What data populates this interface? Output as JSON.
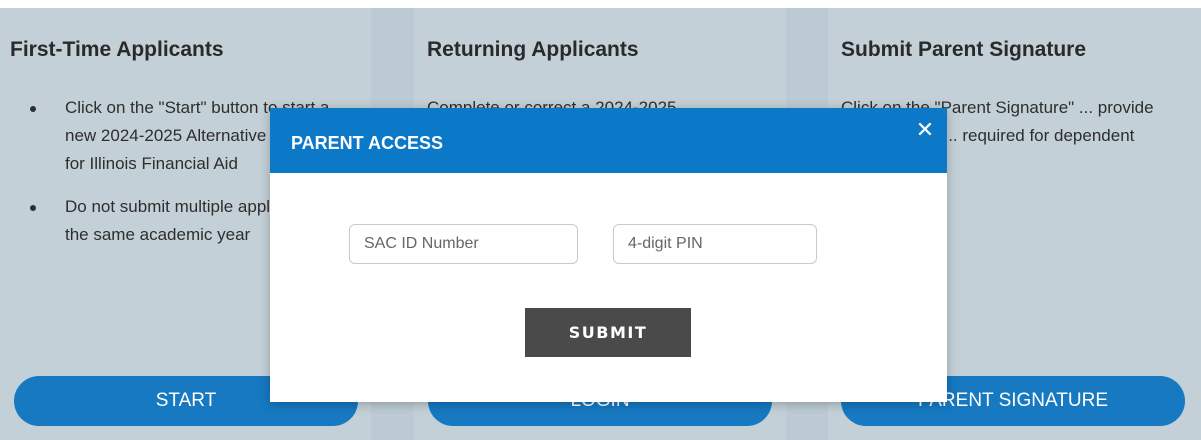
{
  "columns": {
    "first_time": {
      "title": "First-Time Applicants",
      "bullets": [
        "Click on the \"Start\" button to start a new 2024-2025 Alternative Application for Illinois Financial Aid",
        "Do not submit multiple applications for the same academic year"
      ],
      "button": "START"
    },
    "returning": {
      "title": "Returning Applicants",
      "text": "Complete or correct a 2024-2025",
      "button": "LOGIN"
    },
    "parent_sig": {
      "title": "Submit Parent Signature",
      "text": "Click on the \"Parent Signature\" ... provide your parent's ... required for dependent",
      "button": "PARENT SIGNATURE"
    }
  },
  "modal": {
    "title": "PARENT ACCESS",
    "close_symbol": "✕",
    "sac_placeholder": "SAC ID Number",
    "pin_placeholder": "4-digit PIN",
    "submit_label": "SUBMIT"
  }
}
